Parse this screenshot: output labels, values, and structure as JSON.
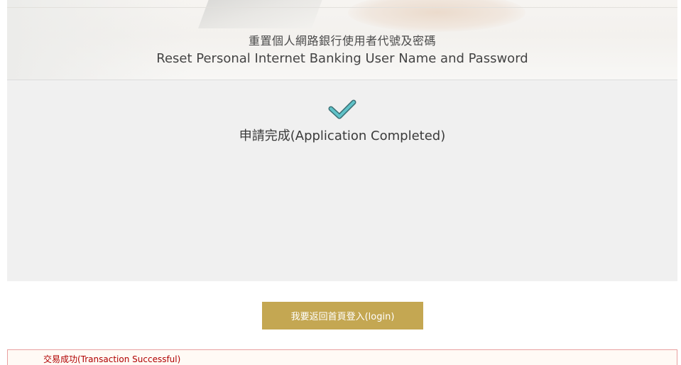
{
  "header": {
    "title_zh": "重置個人網路銀行使用者代號及密碼",
    "title_en": "Reset Personal Internet Banking User Name and Password"
  },
  "result": {
    "icon": "checkmark-icon",
    "icon_color": "#5fc2c8",
    "status_text": "申請完成(Application Completed)"
  },
  "actions": {
    "login_button_label": "我要返回首頁登入(login)",
    "button_color": "#c4a752"
  },
  "alert": {
    "message": "交易成功(Transaction Successful)",
    "text_color": "#b00000"
  }
}
